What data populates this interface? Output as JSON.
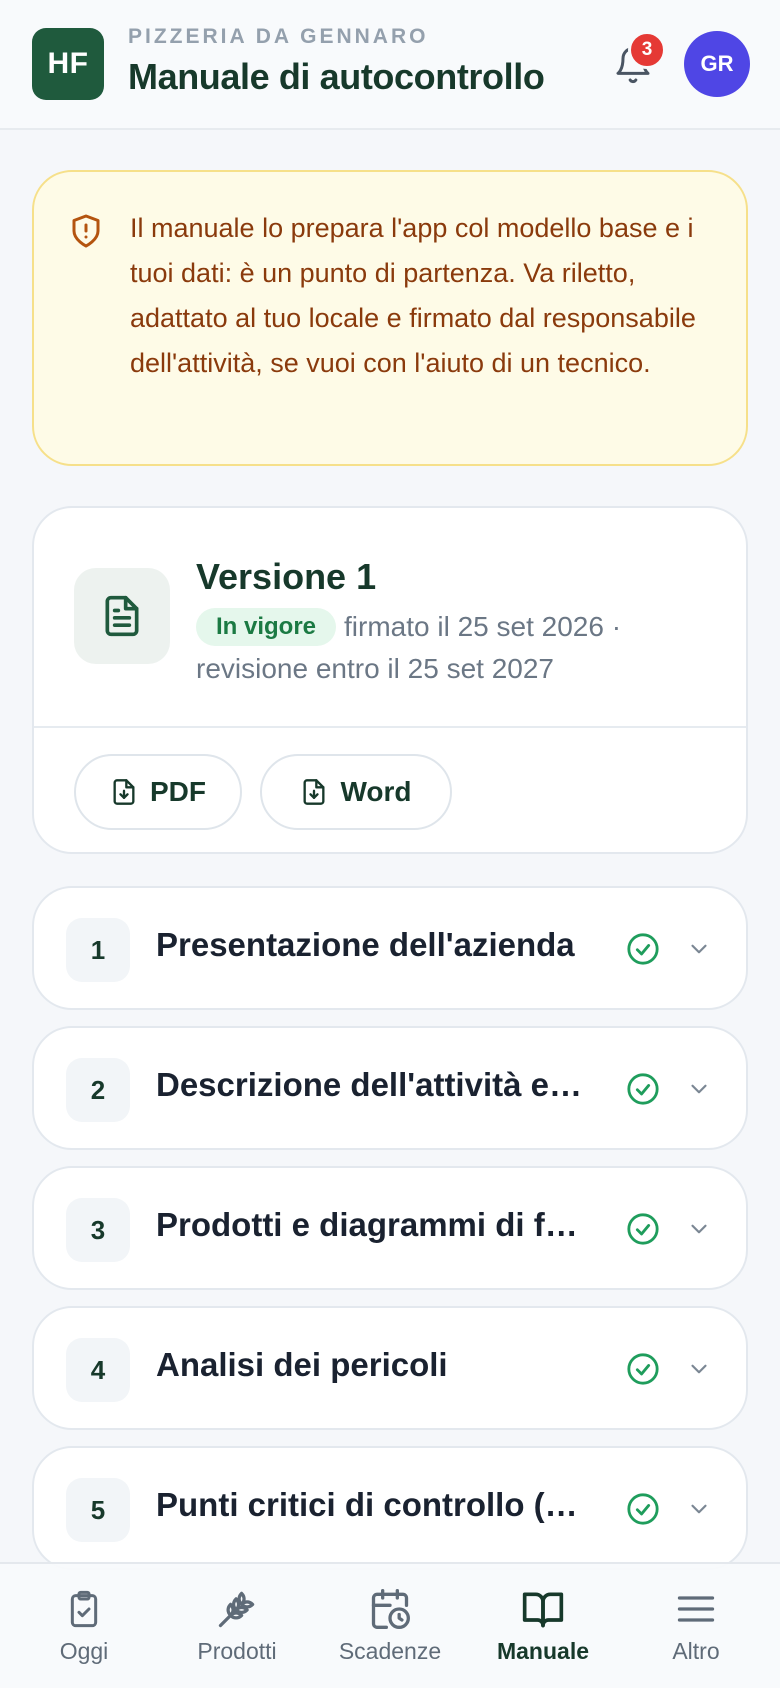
{
  "header": {
    "logo_text": "HF",
    "business_name": "PIZZERIA DA GENNARO",
    "title": "Manuale di autocontrollo",
    "notifications_count": "3",
    "avatar_initials": "GR"
  },
  "notice": {
    "icon": "shield-alert-icon",
    "text": "Il manuale lo prepara l'app col modello base e i tuoi dati: è un punto di partenza. Va riletto, adattato al tuo locale e firmato dal responsabile dell'attività, se vuoi con l'aiuto di un tecnico."
  },
  "version": {
    "title": "Versione 1",
    "status": "In vigore",
    "meta": "firmato il 25 set 2026 · revisione entro il 25 set 2027",
    "downloads": [
      {
        "label": "PDF",
        "icon": "file-download-icon"
      },
      {
        "label": "Word",
        "icon": "file-download-icon"
      }
    ]
  },
  "sections": [
    {
      "num": "1",
      "title": "Presentazione dell'azienda",
      "complete": true
    },
    {
      "num": "2",
      "title": "Descrizione dell'attività e dei locali",
      "complete": true
    },
    {
      "num": "3",
      "title": "Prodotti e diagrammi di flusso",
      "complete": true
    },
    {
      "num": "4",
      "title": "Analisi dei pericoli",
      "complete": true
    },
    {
      "num": "5",
      "title": "Punti critici di controllo (CCP)",
      "complete": true
    }
  ],
  "nav": {
    "items": [
      {
        "label": "Oggi",
        "icon": "clipboard-check-icon"
      },
      {
        "label": "Prodotti",
        "icon": "wheat-icon"
      },
      {
        "label": "Scadenze",
        "icon": "calendar-clock-icon"
      },
      {
        "label": "Manuale",
        "icon": "book-open-icon",
        "active": true
      },
      {
        "label": "Altro",
        "icon": "menu-icon"
      }
    ]
  },
  "colors": {
    "brand": "#1f5a3d",
    "accent_avatar": "#4f46e5",
    "badge": "#e53935",
    "success": "#1f9d5c",
    "notice_bg": "#fefbe7",
    "notice_text": "#8a3a0c"
  }
}
